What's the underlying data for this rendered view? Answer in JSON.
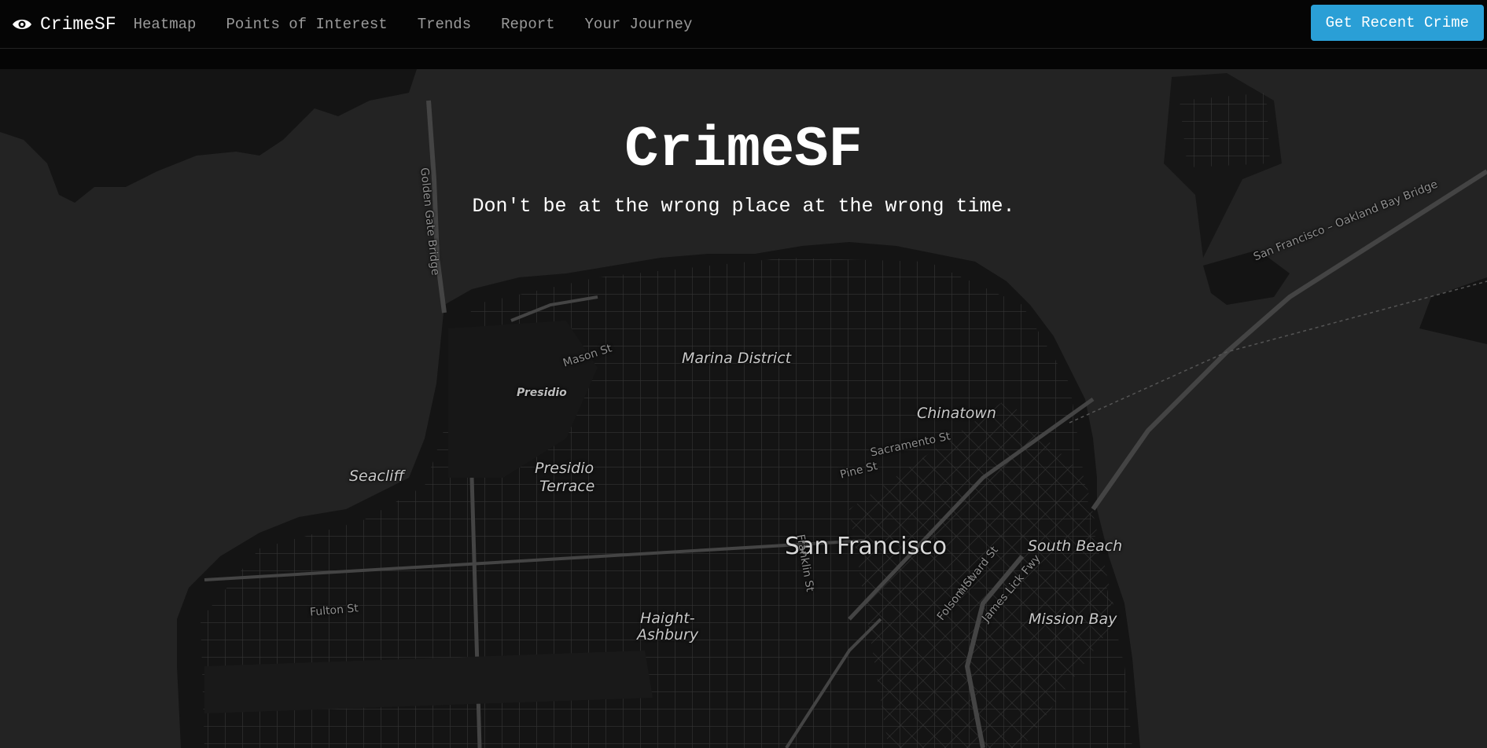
{
  "navbar": {
    "brand": "CrimeSF",
    "links": [
      "Heatmap",
      "Points of Interest",
      "Trends",
      "Report",
      "Your Journey"
    ],
    "cta_label": "Get Recent Crime",
    "cta_color": "#2a9fd6"
  },
  "hero": {
    "title": "CrimeSF",
    "subtitle": "Don't be at the wrong place at the wrong time."
  },
  "map": {
    "labels": {
      "marina": "Marina District",
      "presidio": "Presidio",
      "presidio_terrace": [
        "Presidio",
        "Terrace"
      ],
      "seacliff": "Seacliff",
      "chinatown": "Chinatown",
      "san_francisco": "San Francisco",
      "south_beach": "South Beach",
      "mission_bay": "Mission Bay",
      "haight_ashbury": [
        "Haight-",
        "Ashbury"
      ],
      "mason_st": "Mason St",
      "fulton_st": "Fulton St",
      "sacramento_st": "Sacramento St",
      "pine_st": "Pine St",
      "franklin_st": "Franklin St",
      "howard_st": "Howard St",
      "folsom_st": "Folsom St",
      "james_lick_fwy": "James Lick Fwy",
      "golden_gate_bridge": "Golden Gate Bridge",
      "bay_bridge": "San Francisco – Oakland Bay Bridge"
    },
    "colors": {
      "water": "#232323",
      "land": "#141414",
      "roads": "#3a3a3a"
    }
  }
}
